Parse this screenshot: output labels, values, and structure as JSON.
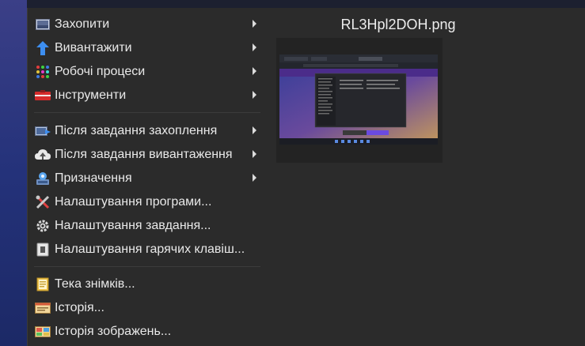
{
  "menu": {
    "items": [
      {
        "label": "Захопити",
        "icon": "capture-icon",
        "submenu": true
      },
      {
        "label": "Вивантажити",
        "icon": "upload-icon",
        "submenu": true
      },
      {
        "label": "Робочі процеси",
        "icon": "workflows-icon",
        "submenu": true
      },
      {
        "label": "Інструменти",
        "icon": "tools-icon",
        "submenu": true
      },
      {
        "label": "Після завдання захоплення",
        "icon": "after-capture-icon",
        "submenu": true
      },
      {
        "label": "Після завдання вивантаження",
        "icon": "after-upload-icon",
        "submenu": true
      },
      {
        "label": "Призначення",
        "icon": "destinations-icon",
        "submenu": true
      },
      {
        "label": "Налаштування програми...",
        "icon": "app-settings-icon",
        "submenu": false
      },
      {
        "label": "Налаштування завдання...",
        "icon": "task-settings-icon",
        "submenu": false
      },
      {
        "label": "Налаштування гарячих клавіш...",
        "icon": "hotkey-settings-icon",
        "submenu": false
      },
      {
        "label": "Тека знімків...",
        "icon": "folder-icon",
        "submenu": false
      },
      {
        "label": "Історія...",
        "icon": "history-icon",
        "submenu": false
      },
      {
        "label": "Історія зображень...",
        "icon": "image-history-icon",
        "submenu": false
      }
    ]
  },
  "preview": {
    "filename": "RL3Hpl2DOH.png"
  }
}
